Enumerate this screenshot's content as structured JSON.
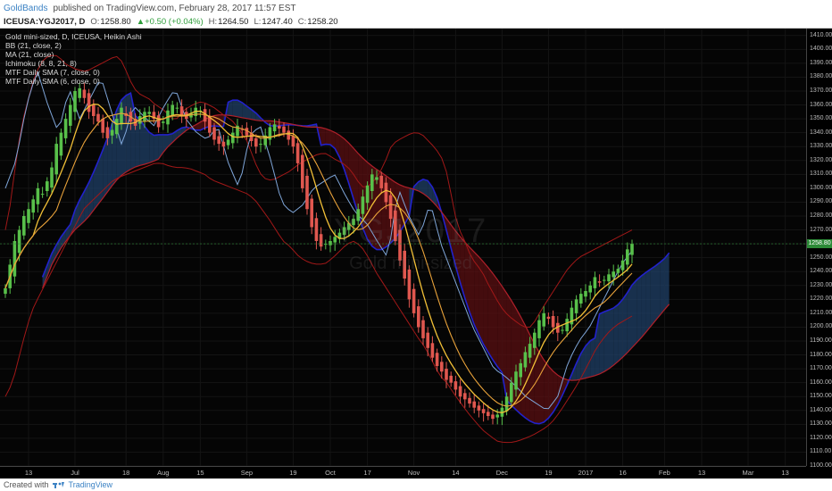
{
  "header": {
    "author": "GoldBands",
    "published": "published on TradingView.com, February 28, 2017 11:57 EST"
  },
  "quote": {
    "symbol": "ICEUSA:YGJ2017, D",
    "open_label": "O:",
    "open": "1258.80",
    "change": "▲+0.50 (+0.04%)",
    "high_label": "H:",
    "high": "1264.50",
    "low_label": "L:",
    "low": "1247.40",
    "close_label": "C:",
    "close": "1258.20"
  },
  "legend": [
    "Gold mini-sized, D, ICEUSA, Heikin Ashi",
    "BB (21, close, 2)",
    "MA (21, close)",
    "Ichimoku (8, 8, 21, 8)",
    "MTF Daily SMA (7, close, 0)",
    "MTF Daily SMA (6, close, 0)"
  ],
  "watermark": {
    "symbol": "YGJ2017",
    "name": "Gold mini-sized"
  },
  "last_price_label": "1258.80",
  "footer": {
    "created_with": "Created with",
    "brand": "TradingView"
  },
  "colors": {
    "bull": "#58c04a",
    "bear": "#e0574f",
    "bb": "#a11818",
    "ma": "#7fa6d9",
    "sma": "#f2c037",
    "kumo_bull": "#1f3f66",
    "kumo_bear": "#5a0f12",
    "kumo_edge": "#2222cc"
  },
  "chart_data": {
    "type": "candlestick",
    "title": "Gold mini-sized, D, ICEUSA, Heikin Ashi",
    "ylim": [
      1100,
      1415
    ],
    "y_ticks": [
      1410,
      1400,
      1390,
      1380,
      1370,
      1360,
      1350,
      1340,
      1330,
      1320,
      1310,
      1300,
      1290,
      1280,
      1270,
      1260,
      1250,
      1240,
      1230,
      1220,
      1210,
      1200,
      1190,
      1180,
      1170,
      1160,
      1150,
      1140,
      1130,
      1120,
      1110,
      1100
    ],
    "x_ticks": [
      {
        "label": "13",
        "i": 5
      },
      {
        "label": "Jul",
        "i": 15
      },
      {
        "label": "18",
        "i": 26
      },
      {
        "label": "Aug",
        "i": 34
      },
      {
        "label": "15",
        "i": 42
      },
      {
        "label": "Sep",
        "i": 52
      },
      {
        "label": "19",
        "i": 62
      },
      {
        "label": "Oct",
        "i": 70
      },
      {
        "label": "17",
        "i": 78
      },
      {
        "label": "Nov",
        "i": 88
      },
      {
        "label": "14",
        "i": 97
      },
      {
        "label": "Dec",
        "i": 107
      },
      {
        "label": "19",
        "i": 117
      },
      {
        "label": "2017",
        "i": 125
      },
      {
        "label": "16",
        "i": 133
      },
      {
        "label": "Feb",
        "i": 142
      },
      {
        "label": "13",
        "i": 150
      },
      {
        "label": "Mar",
        "i": 160
      },
      {
        "label": "13",
        "i": 168
      }
    ],
    "closes": [
      1228,
      1245,
      1262,
      1270,
      1280,
      1285,
      1292,
      1300,
      1296,
      1305,
      1315,
      1332,
      1340,
      1350,
      1360,
      1370,
      1372,
      1365,
      1355,
      1352,
      1348,
      1340,
      1336,
      1342,
      1350,
      1358,
      1352,
      1348,
      1345,
      1352,
      1355,
      1355,
      1350,
      1344,
      1348,
      1356,
      1360,
      1358,
      1352,
      1350,
      1354,
      1358,
      1356,
      1348,
      1340,
      1335,
      1332,
      1330,
      1335,
      1340,
      1345,
      1342,
      1338,
      1334,
      1330,
      1332,
      1338,
      1344,
      1346,
      1343,
      1340,
      1335,
      1330,
      1318,
      1300,
      1285,
      1272,
      1262,
      1258,
      1260,
      1262,
      1265,
      1268,
      1272,
      1275,
      1278,
      1285,
      1294,
      1302,
      1310,
      1308,
      1300,
      1290,
      1278,
      1262,
      1248,
      1235,
      1220,
      1210,
      1200,
      1192,
      1185,
      1178,
      1172,
      1168,
      1162,
      1160,
      1155,
      1150,
      1148,
      1145,
      1142,
      1140,
      1138,
      1136,
      1134,
      1137,
      1142,
      1150,
      1160,
      1168,
      1174,
      1182,
      1188,
      1196,
      1205,
      1210,
      1206,
      1200,
      1196,
      1198,
      1206,
      1214,
      1220,
      1224,
      1226,
      1230,
      1236,
      1232,
      1234,
      1238,
      1240,
      1242,
      1248,
      1256,
      1260
    ],
    "bb_upper": [
      1270,
      1290,
      1320,
      1345,
      1360,
      1375,
      1385,
      1392,
      1395,
      1396,
      1395,
      1390,
      1388,
      1386,
      1385,
      1384,
      1386,
      1388,
      1390,
      1392,
      1394,
      1395,
      1390,
      1380,
      1372,
      1368,
      1366,
      1364,
      1360,
      1358,
      1355,
      1350,
      1350,
      1355,
      1358,
      1360,
      1362,
      1362,
      1360,
      1358,
      1355,
      1352,
      1350,
      1346,
      1340,
      1335,
      1325,
      1315,
      1308,
      1306,
      1306,
      1308,
      1310,
      1312,
      1315,
      1318,
      1320,
      1322,
      1324,
      1325,
      1325,
      1322,
      1320,
      1318,
      1315,
      1310,
      1304,
      1300,
      1302,
      1306,
      1312,
      1320,
      1330,
      1334,
      1336,
      1338,
      1340,
      1340,
      1338,
      1334,
      1330,
      1325,
      1318,
      1300,
      1280,
      1268,
      1260,
      1250,
      1245,
      1240,
      1232,
      1225,
      1218,
      1212,
      1208,
      1205,
      1202,
      1200,
      1200,
      1205,
      1212,
      1218,
      1224,
      1230,
      1236,
      1242,
      1246,
      1250,
      1252,
      1254,
      1256,
      1258,
      1260,
      1262,
      1264,
      1266,
      1268,
      1270
    ],
    "bb_lower": [
      1150,
      1160,
      1180,
      1200,
      1215,
      1225,
      1235,
      1245,
      1255,
      1265,
      1275,
      1285,
      1290,
      1295,
      1300,
      1305,
      1308,
      1310,
      1312,
      1314,
      1316,
      1318,
      1318,
      1316,
      1315,
      1315,
      1314,
      1312,
      1310,
      1306,
      1304,
      1302,
      1300,
      1298,
      1296,
      1292,
      1285,
      1278,
      1270,
      1262,
      1258,
      1252,
      1248,
      1246,
      1245,
      1246,
      1250,
      1255,
      1260,
      1262,
      1258,
      1250,
      1240,
      1232,
      1224,
      1216,
      1208,
      1200,
      1192,
      1185,
      1175,
      1165,
      1160,
      1152,
      1145,
      1138,
      1132,
      1126,
      1122,
      1118,
      1117,
      1117,
      1118,
      1120,
      1122,
      1125,
      1128,
      1133,
      1140,
      1148,
      1156,
      1165,
      1175,
      1185,
      1192,
      1198,
      1202,
      1205,
      1208
    ],
    "ma": [
      1300,
      1320,
      1360,
      1385,
      1360,
      1340,
      1372,
      1350,
      1365,
      1380,
      1355,
      1330,
      1360,
      1352,
      1345,
      1360,
      1372,
      1350,
      1340,
      1335,
      1345,
      1318,
      1300,
      1338,
      1345,
      1320,
      1290,
      1282,
      1288,
      1300,
      1305,
      1310,
      1295,
      1282,
      1275,
      1262,
      1250,
      1300,
      1280,
      1265,
      1290,
      1260,
      1240,
      1220,
      1200,
      1185,
      1170,
      1165,
      1158,
      1150,
      1145,
      1140,
      1150,
      1175,
      1190,
      1200,
      1215,
      1230,
      1245,
      1255
    ]
  }
}
